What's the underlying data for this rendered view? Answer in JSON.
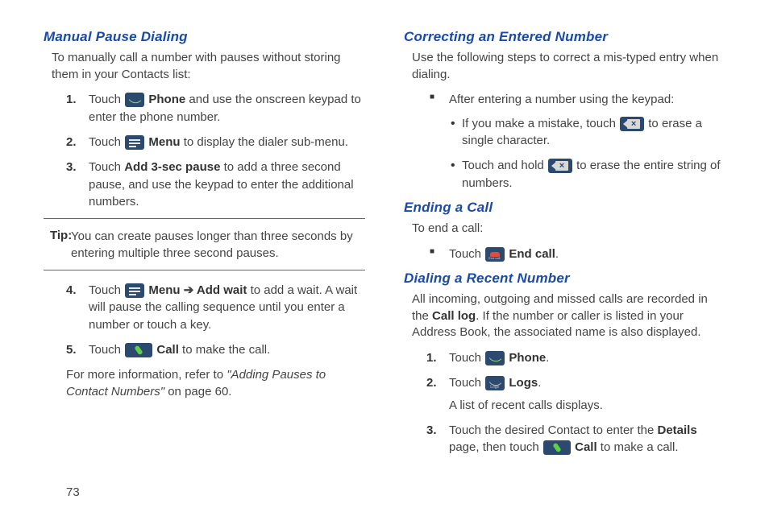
{
  "page_number": "73",
  "left": {
    "h1": "Manual Pause Dialing",
    "intro": "To manually call a number with pauses without storing them in your Contacts list:",
    "items": [
      {
        "num": "1.",
        "pre": "Touch ",
        "bold1": "Phone",
        "post": " and use the onscreen keypad to enter the phone number."
      },
      {
        "num": "2.",
        "pre": "Touch ",
        "bold1": "Menu",
        "post": " to display the dialer sub-menu."
      },
      {
        "num": "3.",
        "pre": "Touch ",
        "bold1": "Add 3-sec pause",
        "post": " to add a three second pause, and use the keypad to enter the additional numbers."
      }
    ],
    "tip_label": "Tip:",
    "tip_text": "You can create pauses longer than three seconds by entering multiple three second pauses.",
    "items2": [
      {
        "num": "4.",
        "pre": "Touch ",
        "bold1": "Menu",
        "arrow": " ➔ ",
        "bold2": "Add wait",
        "post": " to add a wait. A wait will pause the calling sequence until you enter a number or touch a key."
      },
      {
        "num": "5.",
        "pre": "Touch ",
        "bold1": "Call",
        "post": " to make the call."
      }
    ],
    "closing_pre": "For more information, refer to ",
    "closing_ref": "\"Adding Pauses to Contact Numbers\"",
    "closing_post": "  on page 60."
  },
  "right": {
    "h1": "Correcting an Entered Number",
    "intro": "Use the following steps to correct a mis-typed entry when dialing.",
    "bullet1": "After entering a number using the keypad:",
    "sub1_pre": "If you make a mistake, touch ",
    "sub1_post": " to erase a single character.",
    "sub2_pre": "Touch and hold ",
    "sub2_post": " to erase the entire string of numbers.",
    "h2": "Ending a Call",
    "h2_intro": "To end a call:",
    "h2_bullet_pre": "Touch ",
    "h2_bullet_bold": "End call",
    "h2_bullet_post": ".",
    "h3": "Dialing a Recent Number",
    "h3_intro_a": "All incoming, outgoing and missed calls are recorded in the ",
    "h3_intro_bold": "Call log",
    "h3_intro_b": ". If the number or caller is listed in your Address Book, the associated name is also displayed.",
    "h3_items": [
      {
        "num": "1.",
        "pre": "Touch ",
        "bold1": "Phone",
        "post": "."
      },
      {
        "num": "2.",
        "pre": "Touch ",
        "bold1": "Logs",
        "post": "."
      }
    ],
    "h3_note": "A list of recent calls displays.",
    "h3_item3": {
      "num": "3.",
      "pre": "Touch the desired Contact to enter the ",
      "bold1": "Details",
      "mid": " page, then touch ",
      "bold2": "Call",
      "post": " to make a call."
    }
  }
}
